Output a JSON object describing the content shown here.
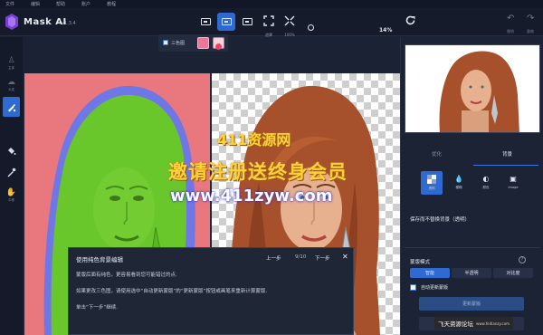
{
  "menu": [
    "文件",
    "编辑",
    "帮助",
    "账户",
    "教程"
  ],
  "app": {
    "title": "Mask AI",
    "version": "v1.3.4"
  },
  "toolbar": {
    "tool_labels": [
      "遮罩",
      "100%"
    ],
    "zoom": "14%",
    "right_labels": [
      "撤销",
      "重做"
    ]
  },
  "left_tools": [
    {
      "label": "主体",
      "icon": "person-icon"
    },
    {
      "label": "头发",
      "icon": "hair-icon"
    },
    {
      "label": "",
      "icon": "brush-icon"
    },
    {
      "label": "",
      "icon": "paint-bucket-icon"
    },
    {
      "label": "",
      "icon": "eyedropper-icon"
    },
    {
      "label": "平移",
      "icon": "hand-icon"
    }
  ],
  "mode_strip": {
    "label": "三色图",
    "colors": [
      "#e8799d",
      "#f7d3dd"
    ]
  },
  "watermark": {
    "line1": "411资源网",
    "line2": "邀请注册送终身会员",
    "line3": "www.411zyw.com"
  },
  "popup": {
    "title": "使用纯色背景编辑",
    "prev": "上一步",
    "step": "9/10",
    "next": "下一步",
    "close": "✕",
    "lines": [
      "蒙版后面有纯色，更容易看到您可能错过的点.",
      "如果更改三色图，请使用选中“自动更新蒙版”的“更新蒙版”按钮或画笔来重新计算蒙版.",
      "单击“下一步”继续."
    ]
  },
  "right_panel": {
    "tabs": [
      "优化",
      "背景"
    ],
    "bg_options": [
      "透明",
      "模糊",
      "颜色",
      "Image"
    ],
    "save_note": "保存而不替换背景（透明）",
    "mask_mode_title": "蒙版模式",
    "info_icon": "?",
    "mask_modes": [
      "智能",
      "半透明",
      "对比度"
    ],
    "auto_update_label": "自动更新蒙版",
    "update_button": "更新蒙版"
  },
  "site_badge": {
    "text": "飞天资源论坛",
    "sub": "www.feitianzy.com"
  },
  "colors": {
    "accent": "#2e6ad1",
    "mask_green": "#69c62a",
    "mask_red": "#e9787e",
    "halo": "#6f77e6"
  }
}
